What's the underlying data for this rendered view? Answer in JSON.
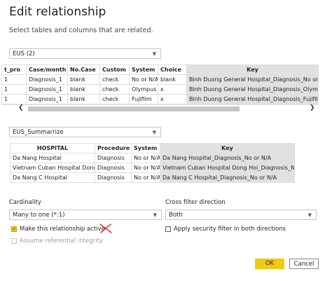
{
  "dialog": {
    "title": "Edit relationship",
    "subtitle": "Select tables and columns that are related."
  },
  "table1": {
    "selected": "EUS (2)",
    "columns": [
      "t_pro",
      "Case/month",
      "No.Case",
      "Custom",
      "System",
      "Choice",
      "Key"
    ],
    "rows": [
      [
        "1",
        "Diagnosis_1",
        "blank",
        "check",
        "No or N/A",
        "blank",
        "Binh Duong General Hospital_Diagnosis_No or N/A"
      ],
      [
        "1",
        "Diagnosis_1",
        "blank",
        "check",
        "Olympus",
        "x",
        "Binh Duong General Hospital_Diagnosis_Olympus"
      ],
      [
        "1",
        "Diagnosis_1",
        "blank",
        "check",
        "Fujifilm",
        "x",
        "Binh Duong General Hospital_Diagnosis_Fujifilm"
      ]
    ]
  },
  "table2": {
    "selected": "EUS_Summarrize",
    "columns": [
      "HOSPITAL",
      "Procedure",
      "System",
      "Key"
    ],
    "rows": [
      [
        "Da Nang Hospital",
        "Diagnosis",
        "No or N/A",
        "Da Nang Hospital_Diagnosis_No or N/A"
      ],
      [
        "Vietnam Cuban Hospital Dong Hoi",
        "Diagnosis",
        "No or N/A",
        "Vietnam Cuban Hospital Dong Hoi_Diagnosis_No or N/A"
      ],
      [
        "Da Nang C Hospital",
        "Diagnosis",
        "No or N/A",
        "Da Nang C Hospital_Diagnosis_No or N/A"
      ]
    ]
  },
  "cardinality": {
    "label": "Cardinality",
    "value": "Many to one (*:1)"
  },
  "cross_filter": {
    "label": "Cross filter direction",
    "value": "Both"
  },
  "options": {
    "active": {
      "label": "Make this relationship active",
      "checked": true
    },
    "security": {
      "label": "Apply security filter in both directions",
      "checked": false
    },
    "referential": {
      "label": "Assume referential integrity",
      "checked": false,
      "disabled": true
    }
  },
  "buttons": {
    "ok": "OK",
    "cancel": "Cancel"
  },
  "icons": {
    "dropdown": "chevron-down-icon",
    "annotation": "red-x-mark-icon"
  },
  "colors": {
    "accent": "#f2c811",
    "key_column": "#e1e1e1",
    "annotation": "#e81123"
  }
}
